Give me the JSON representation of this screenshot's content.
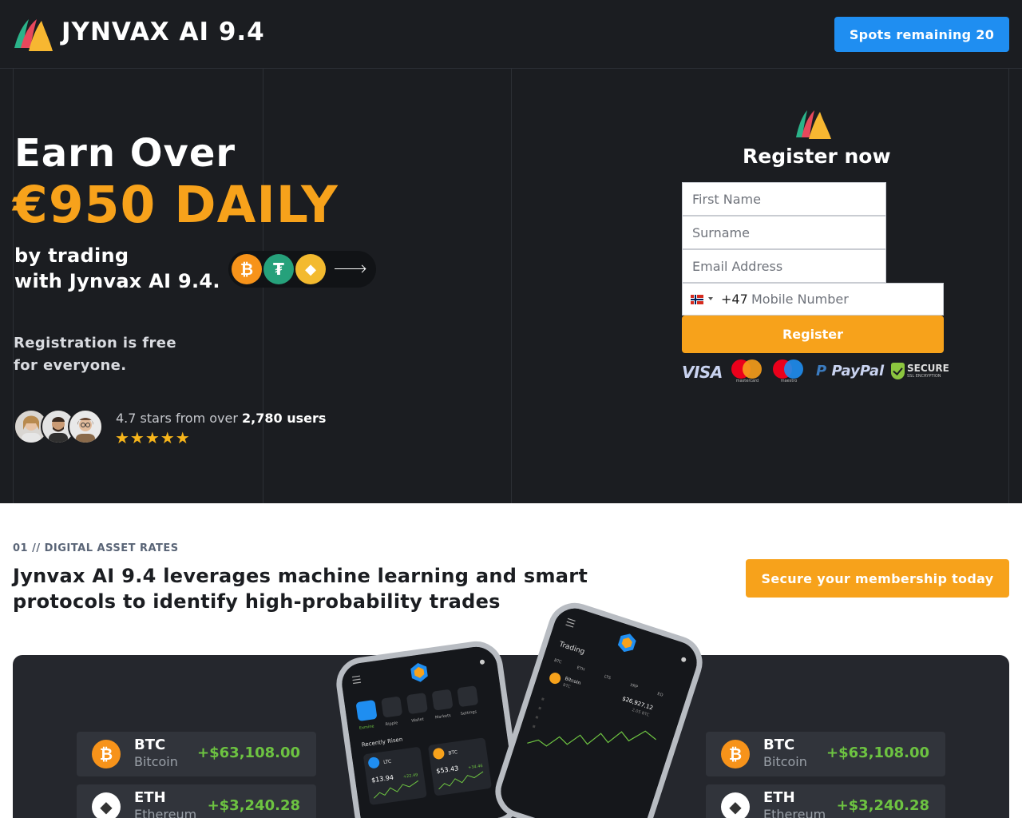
{
  "header": {
    "brand": "JYNVAX AI 9.4",
    "spots_button": "Spots remaining 20"
  },
  "hero": {
    "headline": "Earn Over",
    "amount": "€950 DAILY",
    "subline_1": "by trading",
    "subline_2": "with Jynvax AI 9.4.",
    "reg_free_1": "Registration is free",
    "reg_free_2": "for everyone.",
    "rating_prefix": "4.7 stars from over",
    "rating_users": "2,780 users",
    "stars": "★★★★★",
    "coins": [
      {
        "icon": "bitcoin-icon",
        "symbol": "₿",
        "color": "#f7931a"
      },
      {
        "icon": "tether-icon",
        "symbol": "₮",
        "color": "#26a17b"
      },
      {
        "icon": "binance-icon",
        "symbol": "◆",
        "color": "#f3ba2f"
      }
    ]
  },
  "form": {
    "title": "Register now",
    "first_name_placeholder": "First Name",
    "surname_placeholder": "Surname",
    "email_placeholder": "Email Address",
    "dial_code": "+47",
    "phone_placeholder": "Mobile Number",
    "submit": "Register",
    "payments": {
      "visa": "VISA",
      "mastercard": "mastercard",
      "maestro": "maestro",
      "paypal": "PayPal",
      "secure": "SECURE",
      "secure_sub": "SSL ENCRYPTION"
    }
  },
  "section": {
    "label": "01 // DIGITAL ASSET RATES",
    "title": "Jynvax AI 9.4 leverages machine learning and smart protocols to identify high-probability trades",
    "cta": "Secure your membership today"
  },
  "rates_left": [
    {
      "symbol": "BTC",
      "name": "Bitcoin",
      "value": "+$63,108.00",
      "icon": "bitcoin-icon",
      "glyph": "₿",
      "color": "#f7931a"
    },
    {
      "symbol": "ETH",
      "name": "Ethereum",
      "value": "+$3,240.28",
      "icon": "ethereum-icon",
      "glyph": "◆",
      "color": "#ffffff"
    }
  ],
  "rates_right": [
    {
      "symbol": "BTC",
      "name": "Bitcoin",
      "value": "+$63,108.00",
      "icon": "bitcoin-icon",
      "glyph": "₿",
      "color": "#f7931a"
    },
    {
      "symbol": "ETH",
      "name": "Ethereum",
      "value": "+$3,240.28",
      "icon": "ethereum-icon",
      "glyph": "◆",
      "color": "#ffffff"
    }
  ],
  "phone_app": {
    "tabs": [
      "Exmine",
      "Ripple",
      "Wallet",
      "Markets",
      "Settings"
    ],
    "recent": "Recently Risen",
    "ltc_label": "LTC",
    "ltc_price": "$13.94",
    "ltc_change": "+22.49",
    "btc_label": "BTC",
    "btc_price": "$53.43",
    "btc_change": "+34.46",
    "trading": "Trading",
    "pairs": [
      "BTC",
      "ETH",
      "LTS",
      "XRP",
      "EO"
    ],
    "coin_name": "Bitcoin",
    "coin_sub": "BTC",
    "coin_price": "$26,927.12",
    "coin_amount": "2.05 BTC"
  }
}
